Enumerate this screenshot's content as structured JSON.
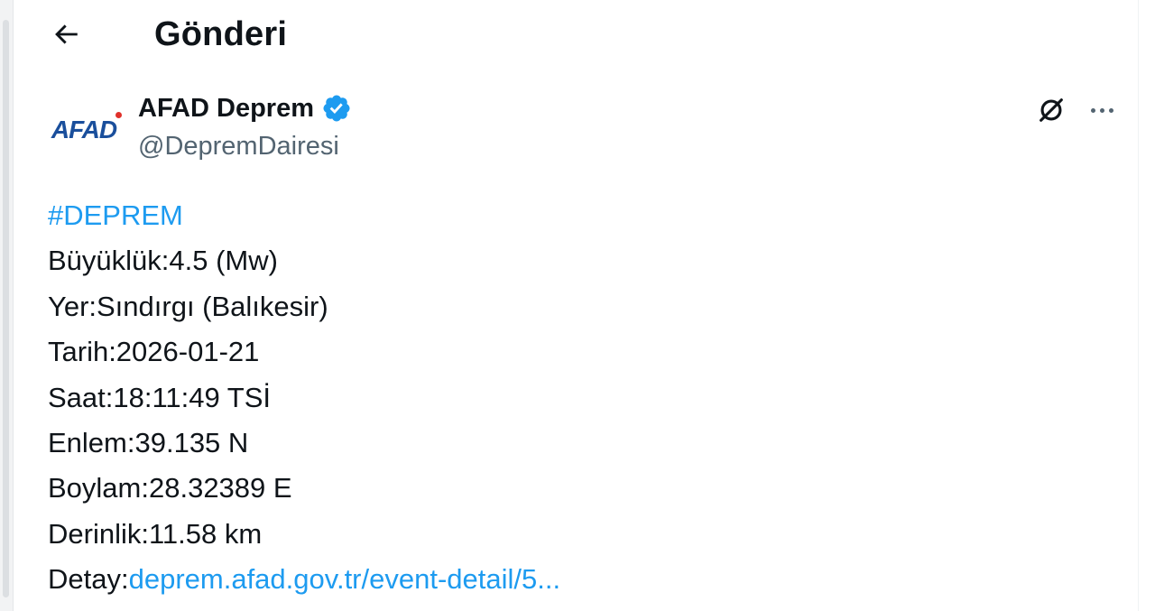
{
  "header": {
    "title": "Gönderi"
  },
  "tweet": {
    "author": {
      "avatar_text": "AFAD",
      "name": "AFAD Deprem",
      "handle": "@DepremDairesi"
    },
    "hashtag": "#DEPREM",
    "lines": [
      "Büyüklük:4.5 (Mw)",
      "Yer:Sındırgı (Balıkesir)",
      "Tarih:2026-01-21",
      "Saat:18:11:49 TSİ",
      "Enlem:39.135 N",
      "Boylam:28.32389 E",
      "Derinlik:11.58 km"
    ],
    "detail_label": "Detay:",
    "detail_link": "deprem.afad.gov.tr/event-detail/5..."
  },
  "icons": {
    "back": "arrow-left-icon",
    "verified": "verified-badge-icon",
    "grok": "grok-icon",
    "more": "more-horizontal-icon"
  },
  "colors": {
    "link": "#1d9bf0",
    "verified": "#1d9bf0",
    "secondary_text": "#536471",
    "brand_blue": "#1a4f9c",
    "brand_red": "#e0312b"
  }
}
